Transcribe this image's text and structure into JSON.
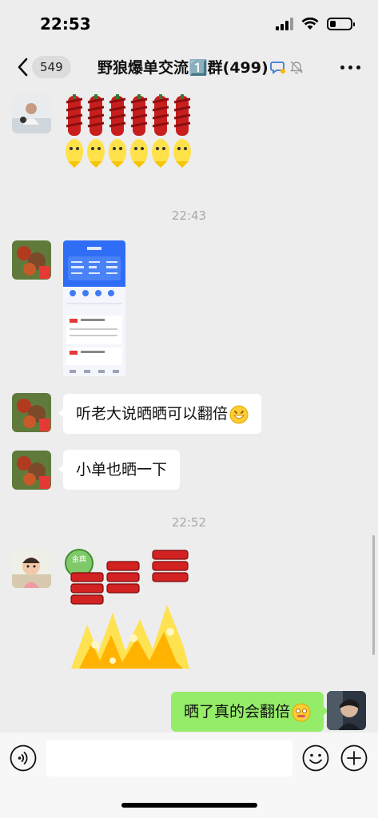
{
  "status_bar": {
    "time": "22:53",
    "battery_level": 0.3
  },
  "header": {
    "unread_count": "549",
    "title": "野狼爆单交流1️⃣群(499)"
  },
  "messages": {
    "timestamp_1": "22:43",
    "timestamp_2": "22:52",
    "msg_text_1": "听老大说晒晒可以翻倍",
    "msg_text_2": "小单也晒一下",
    "msg_text_3": "晒了真的会翻倍",
    "sticker_badge": "金典"
  },
  "input": {
    "placeholder": ""
  },
  "icons": {
    "back": "chevron-left-icon",
    "group": "group-chat-icon",
    "mute": "bell-muted-icon",
    "more": "more-dots-icon",
    "voice": "voice-icon",
    "emoji": "emoji-icon",
    "plus": "plus-icon"
  },
  "colors": {
    "my_bubble": "#95ec69",
    "background": "#ededed"
  }
}
